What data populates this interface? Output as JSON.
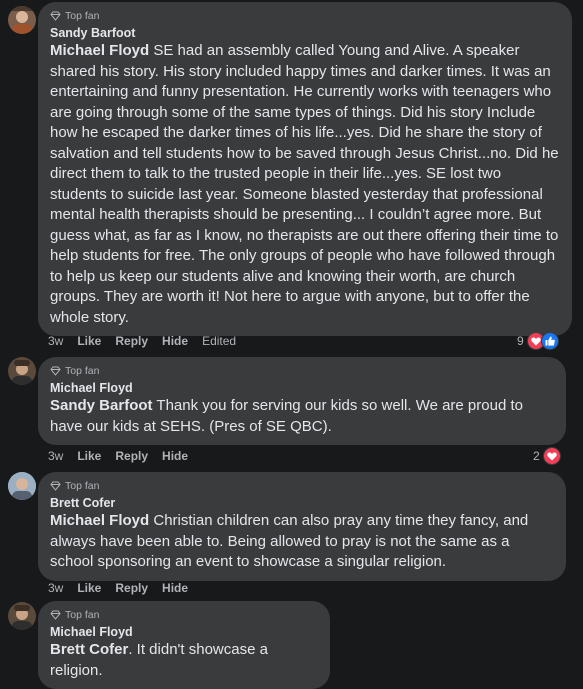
{
  "comments": [
    {
      "badge": "Top fan",
      "author": "Sandy Barfoot",
      "mention": "Michael Floyd",
      "text": " SE had an assembly called Young and Alive. A speaker shared his story. His story included happy times and darker times. It was an entertaining and funny presentation. He currently works with teenagers who are going through some of the same types of things. Did his story Include how he escaped the darker times of his life...yes. Did he share the story of salvation and tell students how to be saved through Jesus Christ...no. Did he direct them to talk to the trusted people in their life...yes. SE lost two students to suicide last year. Someone blasted yesterday that professional mental health therapists should be presenting... I couldn’t agree more. But guess what, as far as I know, no therapists are out there offering their time to help students for free. The only groups of people who have followed through to help us keep our students alive and knowing their worth, are church groups. They are worth it! Not here to argue with anyone, but to offer the whole story.",
      "time": "3w",
      "like": "Like",
      "reply": "Reply",
      "hide": "Hide",
      "edited": "Edited",
      "reaction_count": "9"
    },
    {
      "badge": "Top fan",
      "author": "Michael Floyd",
      "mention": "Sandy Barfoot",
      "text": " Thank you for serving our kids so well. We are proud to have our kids at SEHS. (Pres of SE QBC).",
      "time": "3w",
      "like": "Like",
      "reply": "Reply",
      "hide": "Hide",
      "reaction_count": "2"
    },
    {
      "badge": "Top fan",
      "author": "Brett Cofer",
      "mention": "Michael Floyd",
      "text": " Christian children can also pray any time they fancy, and always have been able to. Being allowed to pray is not the same as a school sponsoring an event to showcase a singular religion.",
      "time": "3w",
      "like": "Like",
      "reply": "Reply",
      "hide": "Hide"
    },
    {
      "badge": "Top fan",
      "author": "Michael Floyd",
      "mention": "Brett Cofer",
      "text": ". It didn't showcase a religion."
    }
  ],
  "colors": {
    "background": "#18191a",
    "bubble": "#3a3b3c",
    "heart": "#f33e58",
    "like": "#1877f2"
  },
  "icons": [
    "diamond-icon",
    "heart-reaction-icon",
    "like-reaction-icon"
  ]
}
